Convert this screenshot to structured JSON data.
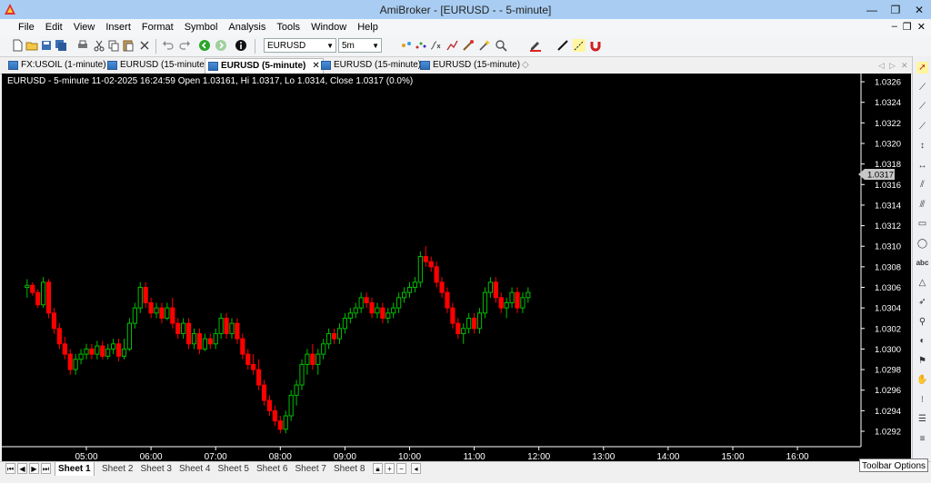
{
  "window": {
    "title": "AmiBroker - [EURUSD -  - 5-minute]",
    "controls": [
      "—",
      "❐",
      "✕"
    ]
  },
  "menu": {
    "items": [
      "File",
      "Edit",
      "View",
      "Insert",
      "Format",
      "Symbol",
      "Analysis",
      "Tools",
      "Window",
      "Help"
    ],
    "mdi": [
      "–",
      "❐",
      "✕"
    ]
  },
  "toolbar": {
    "symbol": "EURUSD",
    "interval": "5m"
  },
  "tabs": [
    {
      "label": "FX:USOIL (1-minute)",
      "active": false
    },
    {
      "label": "EURUSD (15-minute)",
      "active": false
    },
    {
      "label": "EURUSD (5-minute)",
      "active": true
    },
    {
      "label": "EURUSD (15-minute)",
      "active": false
    },
    {
      "label": "EURUSD (15-minute)",
      "active": false
    }
  ],
  "chart_data": {
    "type": "candlestick",
    "title": "EURUSD - 5-minute 11-02-2025 16:24:59 Open 1.03161, Hi 1.0317, Lo 1.0314, Close 1.0317 (0.0%)",
    "ylim": [
      1.02905,
      1.03268
    ],
    "y_ticks": [
      "1.0326",
      "1.0324",
      "1.0322",
      "1.0320",
      "1.0318",
      "1.0316",
      "1.0314",
      "1.0312",
      "1.0310",
      "1.0308",
      "1.0306",
      "1.0304",
      "1.0302",
      "1.0300",
      "1.0298",
      "1.0296",
      "1.0294",
      "1.0292"
    ],
    "y_tick_values": [
      1.0326,
      1.0324,
      1.0322,
      1.032,
      1.0318,
      1.0316,
      1.0314,
      1.0312,
      1.031,
      1.0308,
      1.0306,
      1.0304,
      1.0302,
      1.03,
      1.0298,
      1.0296,
      1.0294,
      1.0292
    ],
    "x_ticks": [
      "05:00",
      "06:00",
      "07:00",
      "08:00",
      "09:00",
      "10:00",
      "11:00",
      "12:00",
      "13:00",
      "14:00",
      "15:00",
      "16:00"
    ],
    "last_price_label": "1.0317",
    "last_price": 1.0317,
    "background": "#000000",
    "up_color": "#00c000",
    "down_color": "#ff0000",
    "candles": [
      {
        "t": "04:05",
        "o": 1.0306,
        "h": 1.03068,
        "l": 1.0305,
        "c": 1.03062
      },
      {
        "t": "04:10",
        "o": 1.03062,
        "h": 1.03065,
        "l": 1.03052,
        "c": 1.03055
      },
      {
        "t": "04:15",
        "o": 1.03055,
        "h": 1.03058,
        "l": 1.0304,
        "c": 1.03043
      },
      {
        "t": "04:20",
        "o": 1.03043,
        "h": 1.0307,
        "l": 1.0304,
        "c": 1.03065
      },
      {
        "t": "04:25",
        "o": 1.03065,
        "h": 1.03068,
        "l": 1.0303,
        "c": 1.03035
      },
      {
        "t": "04:30",
        "o": 1.03035,
        "h": 1.0304,
        "l": 1.03015,
        "c": 1.0302
      },
      {
        "t": "04:35",
        "o": 1.0302,
        "h": 1.03025,
        "l": 1.03,
        "c": 1.03005
      },
      {
        "t": "04:40",
        "o": 1.03005,
        "h": 1.03012,
        "l": 1.0299,
        "c": 1.02995
      },
      {
        "t": "04:45",
        "o": 1.02995,
        "h": 1.03,
        "l": 1.02975,
        "c": 1.0298
      },
      {
        "t": "04:50",
        "o": 1.0298,
        "h": 1.02995,
        "l": 1.02975,
        "c": 1.0299
      },
      {
        "t": "04:55",
        "o": 1.0299,
        "h": 1.03,
        "l": 1.02985,
        "c": 1.02995
      },
      {
        "t": "05:00",
        "o": 1.02995,
        "h": 1.03005,
        "l": 1.0299,
        "c": 1.03
      },
      {
        "t": "05:05",
        "o": 1.03,
        "h": 1.03005,
        "l": 1.0299,
        "c": 1.02995
      },
      {
        "t": "05:10",
        "o": 1.02995,
        "h": 1.03008,
        "l": 1.0299,
        "c": 1.03003
      },
      {
        "t": "05:15",
        "o": 1.03003,
        "h": 1.03008,
        "l": 1.0299,
        "c": 1.02993
      },
      {
        "t": "05:20",
        "o": 1.02993,
        "h": 1.03005,
        "l": 1.0299,
        "c": 1.03
      },
      {
        "t": "05:25",
        "o": 1.03,
        "h": 1.0301,
        "l": 1.02995,
        "c": 1.03005
      },
      {
        "t": "05:30",
        "o": 1.03005,
        "h": 1.0301,
        "l": 1.02988,
        "c": 1.02993
      },
      {
        "t": "05:35",
        "o": 1.02993,
        "h": 1.0301,
        "l": 1.0299,
        "c": 1.03
      },
      {
        "t": "05:40",
        "o": 1.03,
        "h": 1.0303,
        "l": 1.02998,
        "c": 1.03025
      },
      {
        "t": "05:45",
        "o": 1.03025,
        "h": 1.03045,
        "l": 1.0302,
        "c": 1.0304
      },
      {
        "t": "05:50",
        "o": 1.0304,
        "h": 1.03065,
        "l": 1.03035,
        "c": 1.0306
      },
      {
        "t": "05:55",
        "o": 1.0306,
        "h": 1.03065,
        "l": 1.0304,
        "c": 1.03045
      },
      {
        "t": "06:00",
        "o": 1.03045,
        "h": 1.0305,
        "l": 1.0303,
        "c": 1.03035
      },
      {
        "t": "06:05",
        "o": 1.03035,
        "h": 1.03045,
        "l": 1.0303,
        "c": 1.0304
      },
      {
        "t": "06:10",
        "o": 1.0304,
        "h": 1.03045,
        "l": 1.03025,
        "c": 1.0303
      },
      {
        "t": "06:15",
        "o": 1.0303,
        "h": 1.03045,
        "l": 1.03028,
        "c": 1.0304
      },
      {
        "t": "06:20",
        "o": 1.0304,
        "h": 1.0305,
        "l": 1.0302,
        "c": 1.03025
      },
      {
        "t": "06:25",
        "o": 1.03025,
        "h": 1.0303,
        "l": 1.0301,
        "c": 1.03015
      },
      {
        "t": "06:30",
        "o": 1.03015,
        "h": 1.0303,
        "l": 1.0301,
        "c": 1.03025
      },
      {
        "t": "06:35",
        "o": 1.03025,
        "h": 1.0303,
        "l": 1.03,
        "c": 1.03005
      },
      {
        "t": "06:40",
        "o": 1.03005,
        "h": 1.0302,
        "l": 1.03,
        "c": 1.03015
      },
      {
        "t": "06:45",
        "o": 1.03015,
        "h": 1.0302,
        "l": 1.02995,
        "c": 1.03
      },
      {
        "t": "06:50",
        "o": 1.03,
        "h": 1.03015,
        "l": 1.02998,
        "c": 1.0301
      },
      {
        "t": "06:55",
        "o": 1.0301,
        "h": 1.03015,
        "l": 1.03,
        "c": 1.03005
      },
      {
        "t": "07:00",
        "o": 1.03005,
        "h": 1.0302,
        "l": 1.03,
        "c": 1.03015
      },
      {
        "t": "07:05",
        "o": 1.03015,
        "h": 1.03035,
        "l": 1.0301,
        "c": 1.0303
      },
      {
        "t": "07:10",
        "o": 1.0303,
        "h": 1.03035,
        "l": 1.0301,
        "c": 1.03015
      },
      {
        "t": "07:15",
        "o": 1.03015,
        "h": 1.0303,
        "l": 1.0301,
        "c": 1.03025
      },
      {
        "t": "07:20",
        "o": 1.03025,
        "h": 1.0303,
        "l": 1.03005,
        "c": 1.0301
      },
      {
        "t": "07:25",
        "o": 1.0301,
        "h": 1.03015,
        "l": 1.0299,
        "c": 1.02995
      },
      {
        "t": "07:30",
        "o": 1.02995,
        "h": 1.03,
        "l": 1.0298,
        "c": 1.02985
      },
      {
        "t": "07:35",
        "o": 1.02985,
        "h": 1.02995,
        "l": 1.02975,
        "c": 1.0298
      },
      {
        "t": "07:40",
        "o": 1.0298,
        "h": 1.0299,
        "l": 1.0296,
        "c": 1.02965
      },
      {
        "t": "07:45",
        "o": 1.02965,
        "h": 1.0297,
        "l": 1.02945,
        "c": 1.0295
      },
      {
        "t": "07:50",
        "o": 1.0295,
        "h": 1.02955,
        "l": 1.02935,
        "c": 1.0294
      },
      {
        "t": "07:55",
        "o": 1.0294,
        "h": 1.02945,
        "l": 1.02925,
        "c": 1.0293
      },
      {
        "t": "08:00",
        "o": 1.0293,
        "h": 1.02935,
        "l": 1.02918,
        "c": 1.02922
      },
      {
        "t": "08:05",
        "o": 1.02922,
        "h": 1.0294,
        "l": 1.02918,
        "c": 1.02935
      },
      {
        "t": "08:10",
        "o": 1.02935,
        "h": 1.0296,
        "l": 1.0293,
        "c": 1.02955
      },
      {
        "t": "08:15",
        "o": 1.02955,
        "h": 1.0297,
        "l": 1.02945,
        "c": 1.02965
      },
      {
        "t": "08:20",
        "o": 1.02965,
        "h": 1.0299,
        "l": 1.0296,
        "c": 1.02985
      },
      {
        "t": "08:25",
        "o": 1.02985,
        "h": 1.03,
        "l": 1.02975,
        "c": 1.02995
      },
      {
        "t": "08:30",
        "o": 1.02995,
        "h": 1.03005,
        "l": 1.0298,
        "c": 1.02985
      },
      {
        "t": "08:35",
        "o": 1.02985,
        "h": 1.03,
        "l": 1.02975,
        "c": 1.02995
      },
      {
        "t": "08:40",
        "o": 1.02995,
        "h": 1.0301,
        "l": 1.0299,
        "c": 1.03005
      },
      {
        "t": "08:45",
        "o": 1.03005,
        "h": 1.0302,
        "l": 1.03,
        "c": 1.03015
      },
      {
        "t": "08:50",
        "o": 1.03015,
        "h": 1.0302,
        "l": 1.03005,
        "c": 1.0301
      },
      {
        "t": "08:55",
        "o": 1.0301,
        "h": 1.03025,
        "l": 1.03005,
        "c": 1.0302
      },
      {
        "t": "09:00",
        "o": 1.0302,
        "h": 1.03035,
        "l": 1.03015,
        "c": 1.0303
      },
      {
        "t": "09:05",
        "o": 1.0303,
        "h": 1.0304,
        "l": 1.03025,
        "c": 1.03035
      },
      {
        "t": "09:10",
        "o": 1.03035,
        "h": 1.03045,
        "l": 1.0303,
        "c": 1.0304
      },
      {
        "t": "09:15",
        "o": 1.0304,
        "h": 1.03055,
        "l": 1.03035,
        "c": 1.0305
      },
      {
        "t": "09:20",
        "o": 1.0305,
        "h": 1.03055,
        "l": 1.0304,
        "c": 1.03045
      },
      {
        "t": "09:25",
        "o": 1.03045,
        "h": 1.0305,
        "l": 1.0303,
        "c": 1.03035
      },
      {
        "t": "09:30",
        "o": 1.03035,
        "h": 1.03045,
        "l": 1.0303,
        "c": 1.0304
      },
      {
        "t": "09:35",
        "o": 1.0304,
        "h": 1.03045,
        "l": 1.03025,
        "c": 1.0303
      },
      {
        "t": "09:40",
        "o": 1.0303,
        "h": 1.0304,
        "l": 1.03025,
        "c": 1.03035
      },
      {
        "t": "09:45",
        "o": 1.03035,
        "h": 1.03045,
        "l": 1.0303,
        "c": 1.0304
      },
      {
        "t": "09:50",
        "o": 1.0304,
        "h": 1.03055,
        "l": 1.03035,
        "c": 1.0305
      },
      {
        "t": "09:55",
        "o": 1.0305,
        "h": 1.0306,
        "l": 1.03045,
        "c": 1.03055
      },
      {
        "t": "10:00",
        "o": 1.03055,
        "h": 1.03065,
        "l": 1.0305,
        "c": 1.0306
      },
      {
        "t": "10:05",
        "o": 1.0306,
        "h": 1.0307,
        "l": 1.03055,
        "c": 1.03065
      },
      {
        "t": "10:10",
        "o": 1.03065,
        "h": 1.03095,
        "l": 1.0306,
        "c": 1.0309
      },
      {
        "t": "10:15",
        "o": 1.0309,
        "h": 1.031,
        "l": 1.0308,
        "c": 1.03085
      },
      {
        "t": "10:20",
        "o": 1.03085,
        "h": 1.0309,
        "l": 1.03075,
        "c": 1.0308
      },
      {
        "t": "10:25",
        "o": 1.0308,
        "h": 1.03085,
        "l": 1.0306,
        "c": 1.03065
      },
      {
        "t": "10:30",
        "o": 1.03065,
        "h": 1.0307,
        "l": 1.0305,
        "c": 1.03055
      },
      {
        "t": "10:35",
        "o": 1.03055,
        "h": 1.0306,
        "l": 1.03035,
        "c": 1.0304
      },
      {
        "t": "10:40",
        "o": 1.0304,
        "h": 1.03045,
        "l": 1.0302,
        "c": 1.03025
      },
      {
        "t": "10:45",
        "o": 1.03025,
        "h": 1.0303,
        "l": 1.0301,
        "c": 1.03015
      },
      {
        "t": "10:50",
        "o": 1.03015,
        "h": 1.03025,
        "l": 1.03005,
        "c": 1.0302
      },
      {
        "t": "10:55",
        "o": 1.0302,
        "h": 1.03035,
        "l": 1.03015,
        "c": 1.0303
      },
      {
        "t": "11:00",
        "o": 1.0303,
        "h": 1.03035,
        "l": 1.03015,
        "c": 1.0302
      },
      {
        "t": "11:05",
        "o": 1.0302,
        "h": 1.0304,
        "l": 1.03015,
        "c": 1.03035
      },
      {
        "t": "11:10",
        "o": 1.03035,
        "h": 1.0306,
        "l": 1.0303,
        "c": 1.03055
      },
      {
        "t": "11:15",
        "o": 1.03055,
        "h": 1.0307,
        "l": 1.0305,
        "c": 1.03065
      },
      {
        "t": "11:20",
        "o": 1.03065,
        "h": 1.0307,
        "l": 1.03045,
        "c": 1.0305
      },
      {
        "t": "11:25",
        "o": 1.0305,
        "h": 1.03055,
        "l": 1.03035,
        "c": 1.0304
      },
      {
        "t": "11:30",
        "o": 1.0304,
        "h": 1.0305,
        "l": 1.0303,
        "c": 1.03045
      },
      {
        "t": "11:35",
        "o": 1.03045,
        "h": 1.0306,
        "l": 1.0304,
        "c": 1.03055
      },
      {
        "t": "11:40",
        "o": 1.03055,
        "h": 1.0306,
        "l": 1.03035,
        "c": 1.0304
      },
      {
        "t": "11:45",
        "o": 1.0304,
        "h": 1.03055,
        "l": 1.03035,
        "c": 1.0305
      },
      {
        "t": "11:50",
        "o": 1.0305,
        "h": 1.0306,
        "l": 1.03045,
        "c": 1.03055
      }
    ]
  },
  "right_tools": [
    "cursor-tool",
    "line-tool",
    "ray-tool",
    "trendline-tool",
    "vertical-line-tool",
    "horizontal-line-tool",
    "parallel-tool",
    "fib-tool",
    "rectangle-tool",
    "ellipse-tool",
    "text-tool",
    "triangle-tool",
    "arrow-tool",
    "zoom-tool",
    "color-tool",
    "symbol-tool",
    "hand-tool",
    "more-tools",
    "grid-tool",
    "menu-tool"
  ],
  "sheets": {
    "items": [
      "Sheet 1",
      "Sheet 2",
      "Sheet 3",
      "Sheet 4",
      "Sheet 5",
      "Sheet 6",
      "Sheet 7",
      "Sheet 8"
    ],
    "active": 0
  },
  "tooltip": {
    "text": "Toolbar Options"
  }
}
